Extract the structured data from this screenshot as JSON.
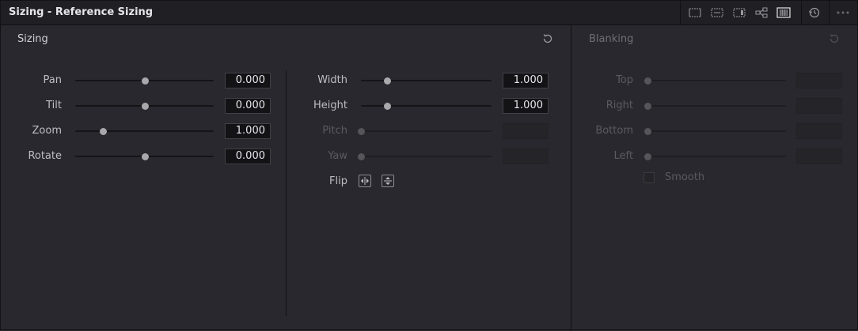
{
  "window": {
    "title": "Sizing - Reference Sizing"
  },
  "toolbar": {
    "icons": [
      "output-sizing-icon",
      "input-sizing-icon",
      "edit-sizing-icon",
      "node-sizing-icon",
      "reference-sizing-icon",
      "reset-history-icon",
      "more-options-icon"
    ]
  },
  "sizing": {
    "title": "Sizing",
    "left": [
      {
        "label": "Pan",
        "value": "0.000",
        "position": 0.5
      },
      {
        "label": "Tilt",
        "value": "0.000",
        "position": 0.5
      },
      {
        "label": "Zoom",
        "value": "1.000",
        "position": 0.2
      },
      {
        "label": "Rotate",
        "value": "0.000",
        "position": 0.5
      }
    ],
    "right": [
      {
        "label": "Width",
        "value": "1.000",
        "position": 0.2,
        "enabled": true
      },
      {
        "label": "Height",
        "value": "1.000",
        "position": 0.2,
        "enabled": true
      },
      {
        "label": "Pitch",
        "value": "",
        "position": 0.0,
        "enabled": false
      },
      {
        "label": "Yaw",
        "value": "",
        "position": 0.0,
        "enabled": false
      }
    ],
    "flip_label": "Flip"
  },
  "blanking": {
    "title": "Blanking",
    "rows": [
      {
        "label": "Top",
        "value": ""
      },
      {
        "label": "Right",
        "value": ""
      },
      {
        "label": "Bottom",
        "value": ""
      },
      {
        "label": "Left",
        "value": ""
      }
    ],
    "smooth_label": "Smooth",
    "smooth_checked": false
  }
}
